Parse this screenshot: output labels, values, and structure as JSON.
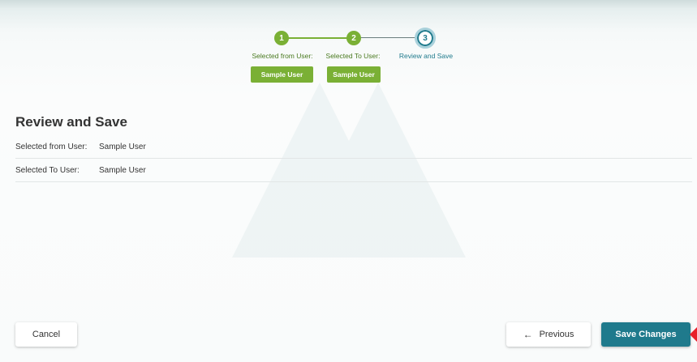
{
  "stepper": {
    "steps": [
      {
        "number": "1",
        "label": "Selected from User:",
        "value": "Sample User",
        "state": "complete"
      },
      {
        "number": "2",
        "label": "Selected To User:",
        "value": "Sample User",
        "state": "complete"
      },
      {
        "number": "3",
        "label": "Review and Save",
        "state": "current"
      }
    ]
  },
  "review": {
    "title": "Review and Save",
    "rows": [
      {
        "key": "Selected from User:",
        "value": "Sample User"
      },
      {
        "key": "Selected To User:",
        "value": "Sample User"
      }
    ]
  },
  "footer": {
    "cancel_label": "Cancel",
    "previous_label": "Previous",
    "previous_icon": "arrow-left-icon",
    "save_label": "Save Changes"
  },
  "colors": {
    "complete_green": "#7ab035",
    "primary_teal": "#1f7a8c",
    "pointer_red": "#e8202a"
  }
}
